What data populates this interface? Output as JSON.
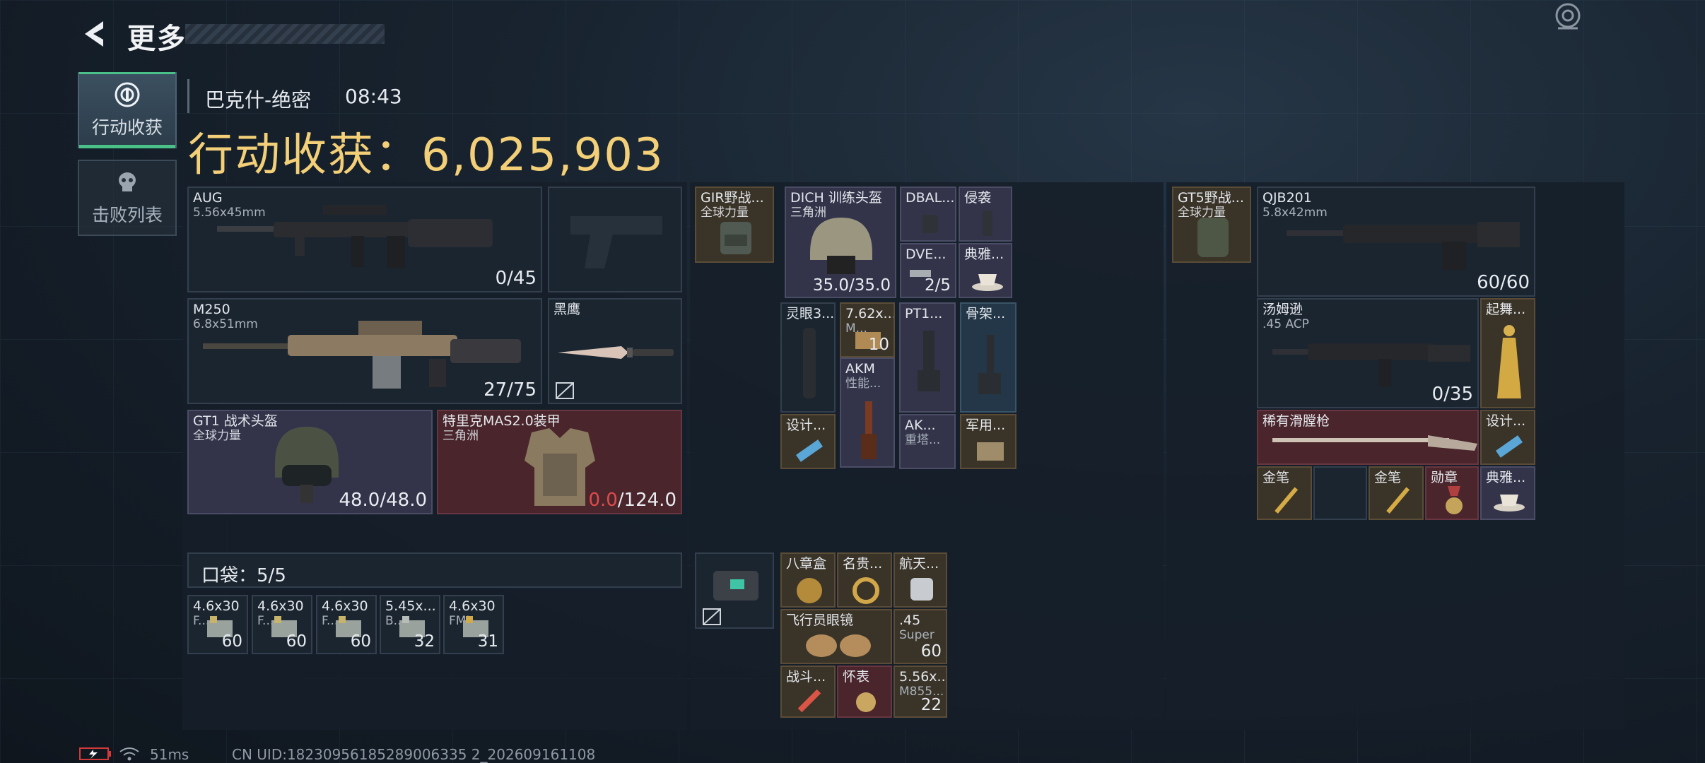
{
  "header": {
    "title": "更多",
    "map": "巴克什-绝密",
    "time": "08:43",
    "loot_label": "行动收获：6,025,903"
  },
  "tabs": [
    {
      "label": "行动收获"
    },
    {
      "label": "击败列表"
    }
  ],
  "pocket": {
    "label": "口袋：",
    "count": "5/5"
  },
  "footer": {
    "ping": "51ms",
    "uid": "CN UID:18230956185289006335 2_202609161108"
  },
  "weapons": {
    "aug": {
      "name": "AUG",
      "ammo": "5.56x45mm",
      "count": "0/45"
    },
    "m250": {
      "name": "M250",
      "ammo": "6.8x51mm",
      "count": "27/75"
    },
    "knife": {
      "name": "黑鹰"
    },
    "helmet": {
      "name": "GT1 战术头盔",
      "sub": "全球力量",
      "count": "48.0/48.0"
    },
    "armor": {
      "name": "特里克MAS2.0装甲",
      "sub": "三角洲",
      "count_damaged": "0.0",
      "count_max": "/124.0"
    }
  },
  "pocket_items": [
    {
      "name": "4.6x30",
      "sub": "F...",
      "count": "60"
    },
    {
      "name": "4.6x30",
      "sub": "F...",
      "count": "60"
    },
    {
      "name": "4.6x30",
      "sub": "F...",
      "count": "60"
    },
    {
      "name": "5.45x...",
      "sub": "B...",
      "count": "32"
    },
    {
      "name": "4.6x30",
      "sub": "FMJ...",
      "count": "31"
    }
  ],
  "middle": {
    "rig": {
      "name": "GIR野战...",
      "sub": "全球力量"
    },
    "dich": {
      "name": "DICH 训练头盔",
      "sub": "三角洲",
      "count": "35.0/35.0"
    },
    "dbal": {
      "name": "DBAL..."
    },
    "qinxi": {
      "name": "侵袭"
    },
    "dve": {
      "name": "DVE...",
      "count": "2/5"
    },
    "dianya1": {
      "name": "典雅..."
    },
    "lingyan": {
      "name": "灵眼3..."
    },
    "ammo762": {
      "name": "7.62x...",
      "sub": "M...",
      "count": "10"
    },
    "akm": {
      "name": "AKM",
      "sub": "性能..."
    },
    "pt1": {
      "name": "PT1..."
    },
    "gujia": {
      "name": "骨架..."
    },
    "sheji1": {
      "name": "设计..."
    },
    "ak": {
      "name": "AK...",
      "sub": "重塔..."
    },
    "junyong": {
      "name": "军用..."
    },
    "case": {},
    "bazhang": {
      "name": "八章盒"
    },
    "mingui": {
      "name": "名贵..."
    },
    "hangtian": {
      "name": "航天..."
    },
    "feixing": {
      "name": "飞行员眼镜"
    },
    "ammo45": {
      "name": ".45",
      "sub": "Super",
      "count": "60"
    },
    "zhandou": {
      "name": "战斗..."
    },
    "huaibiao": {
      "name": "怀表"
    },
    "ammo556": {
      "name": "5.56x...",
      "sub": "M855...",
      "count": "22"
    }
  },
  "right": {
    "gt5": {
      "name": "GT5野战...",
      "sub": "全球力量"
    },
    "qjb": {
      "name": "QJB201",
      "ammo": "5.8x42mm",
      "count": "60/60"
    },
    "thompson": {
      "name": "汤姆逊",
      "ammo": ".45 ACP",
      "count": "0/35"
    },
    "qiwu": {
      "name": "起舞..."
    },
    "flintlock": {
      "name": "稀有滑膛枪"
    },
    "sheji2": {
      "name": "设计..."
    },
    "jinbi1": {
      "name": "金笔"
    },
    "jinbi2": {
      "name": "金笔"
    },
    "xunzhang": {
      "name": "勋章"
    },
    "dianya2": {
      "name": "典雅..."
    }
  }
}
